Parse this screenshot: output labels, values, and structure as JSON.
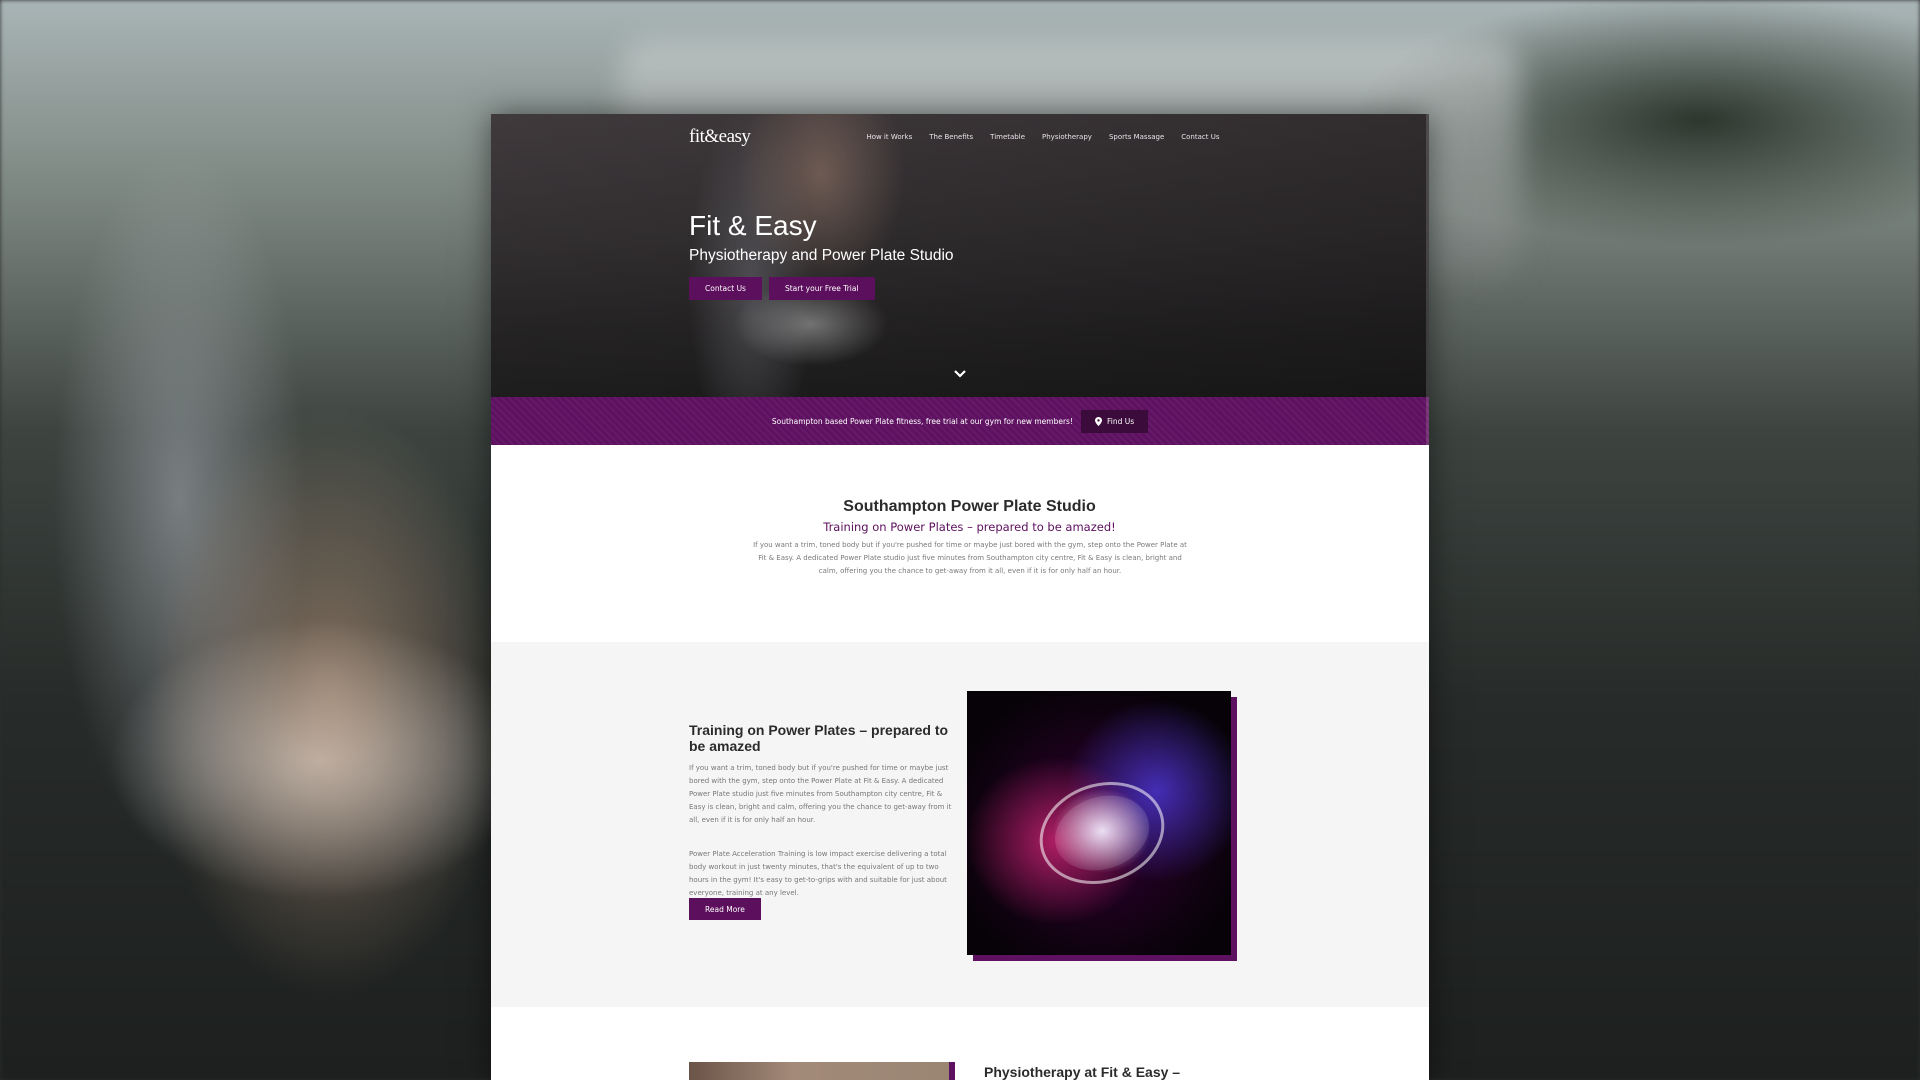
{
  "site": {
    "logo": "fit&easy",
    "nav": [
      "How it Works",
      "The Benefits",
      "Timetable",
      "Physiotherapy",
      "Sports Massage",
      "Contact Us"
    ]
  },
  "hero": {
    "title": "Fit & Easy",
    "subtitle": "Physiotherapy and Power Plate Studio",
    "buttons": {
      "contact": "Contact Us",
      "trial": "Start your Free Trial"
    },
    "scroll_icon": "chevron-down-icon"
  },
  "promo": {
    "text": "Southampton based Power Plate fitness, free trial at our gym for new members!",
    "button": "Find Us",
    "button_icon": "map-pin-icon"
  },
  "intro": {
    "title": "Southampton Power Plate Studio",
    "subtitle": "Training on Power Plates – prepared to be amazed!",
    "body": "If you want a trim, toned body but if you're pushed for time or maybe just bored with the gym, step onto the Power Plate at Fit & Easy. A dedicated Power Plate studio just five minutes from Southampton city centre, Fit & Easy is clean, bright and calm, offering you the chance to get-away from it all, even if it is for only half an hour."
  },
  "feature": {
    "title": "Training on Power Plates – prepared to be amazed",
    "p1": "If you want a trim, toned body but if you're pushed for time or maybe just bored with the gym, step onto the Power Plate at Fit & Easy. A dedicated Power Plate studio just five minutes from Southampton city centre, Fit & Easy is clean, bright and calm, offering you the chance to get-away from it all, even if it is for only half an hour.",
    "p2": "Power Plate Acceleration Training is low impact exercise delivering a total body workout in just twenty minutes, that's the equivalent of up to two hours in the gym! It's easy to get-to-grips with and suitable for just about everyone, training at any level.",
    "button": "Read More"
  },
  "next": {
    "title": "Physiotherapy at Fit & Easy –"
  },
  "colors": {
    "brand_purple": "#5e1160",
    "dark_purple": "#3a0b3b"
  }
}
